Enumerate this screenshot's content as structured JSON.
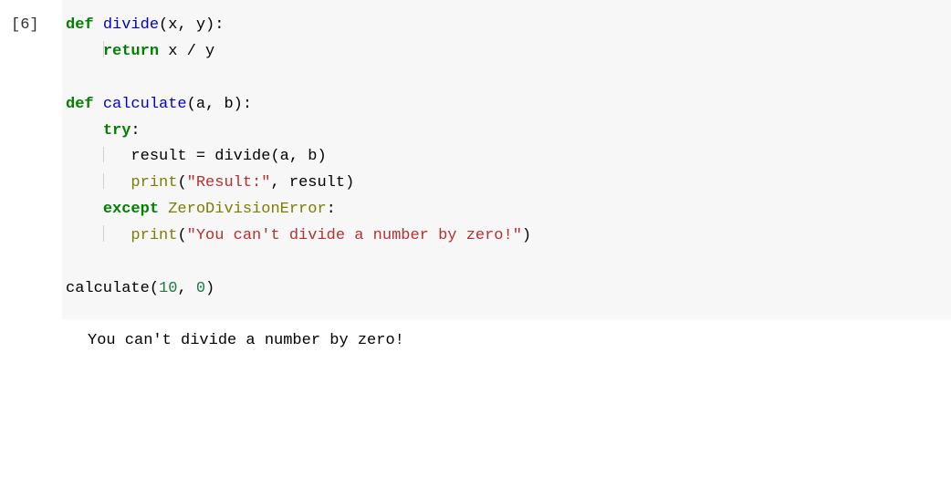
{
  "cell": {
    "execution_count": "[6]",
    "code": {
      "t": {
        "def": "def",
        "return": "return",
        "try": "try",
        "except": "except",
        "divide": "divide",
        "calculate": "calculate",
        "ZeroDivisionError": "ZeroDivisionError",
        "print": "print",
        "s_result": "\"Result:\"",
        "s_zero": "\"You can't divide a number by zero!\"",
        "n10": "10",
        "n0": "0",
        "lp": "(",
        "rp": ")",
        "colon": ":",
        "comma_sp": ", ",
        "sp": " ",
        "x": "x",
        "y": "y",
        "a": "a",
        "b": "b",
        "slash": " / ",
        "eq": " = ",
        "result_id": "result",
        "divide_call": "divide(a, b)",
        "print_result_tail": ", result)",
        "calc_call_head": "calculate(",
        "comma_sp2": ", ",
        "rp2": ")"
      }
    },
    "output": "You can't divide a number by zero!"
  }
}
